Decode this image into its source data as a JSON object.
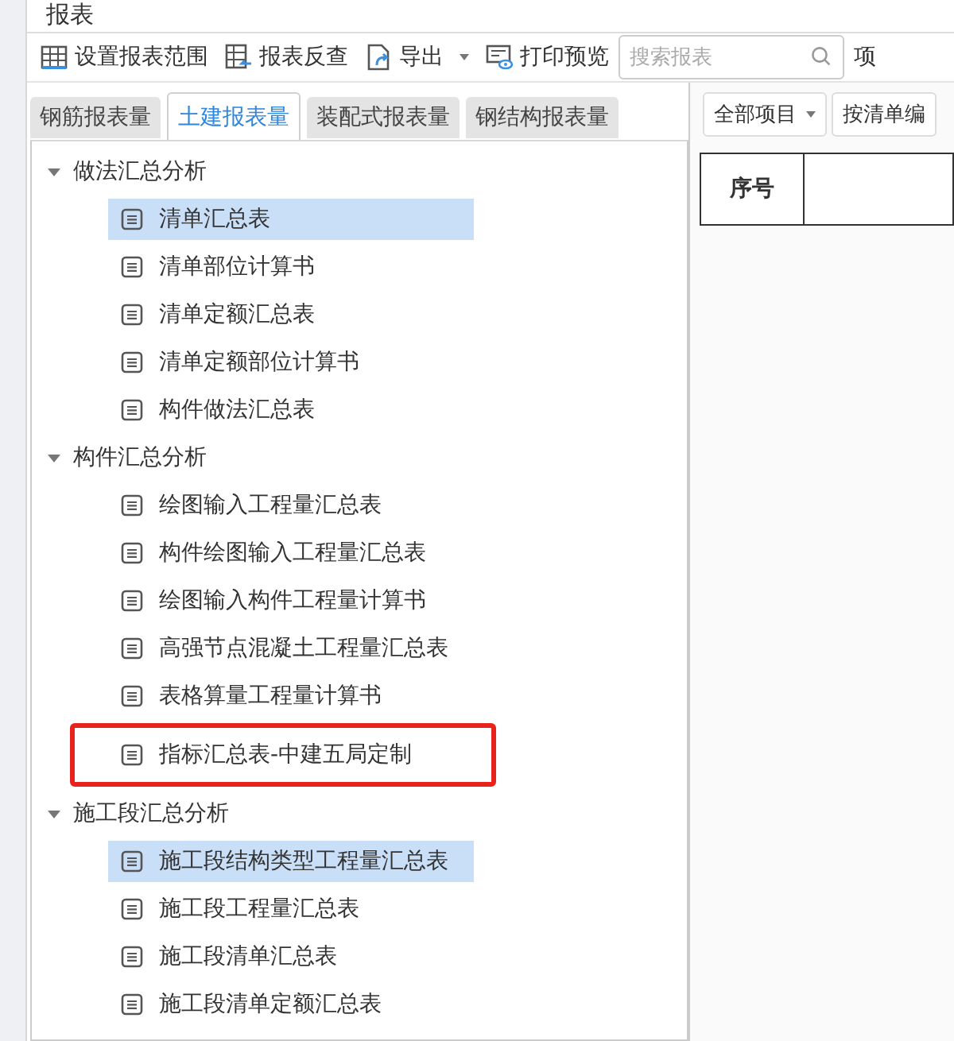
{
  "window": {
    "title": "报表"
  },
  "toolbar": [
    {
      "label": "设置报表范围",
      "kind": "grid"
    },
    {
      "label": "报表反查",
      "kind": "lookup"
    },
    {
      "label": "导出",
      "kind": "export",
      "dropdown": true
    },
    {
      "label": "打印预览",
      "kind": "print"
    }
  ],
  "search": {
    "placeholder": "搜索报表"
  },
  "toolbar_cut_label": "项",
  "tabs": [
    {
      "label": "钢筋报表量",
      "selected": false
    },
    {
      "label": "土建报表量",
      "selected": true
    },
    {
      "label": "装配式报表量",
      "selected": false
    },
    {
      "label": "钢结构报表量",
      "selected": false
    }
  ],
  "tree": [
    {
      "label": "做法汇总分析",
      "expanded": true,
      "children": [
        {
          "label": "清单汇总表",
          "selected": true,
          "highlighted": false
        },
        {
          "label": "清单部位计算书",
          "selected": false,
          "highlighted": false
        },
        {
          "label": "清单定额汇总表",
          "selected": false,
          "highlighted": false
        },
        {
          "label": "清单定额部位计算书",
          "selected": false,
          "highlighted": false
        },
        {
          "label": "构件做法汇总表",
          "selected": false,
          "highlighted": false
        }
      ]
    },
    {
      "label": "构件汇总分析",
      "expanded": true,
      "children": [
        {
          "label": "绘图输入工程量汇总表",
          "selected": false,
          "highlighted": false
        },
        {
          "label": "构件绘图输入工程量汇总表",
          "selected": false,
          "highlighted": false
        },
        {
          "label": "绘图输入构件工程量计算书",
          "selected": false,
          "highlighted": false
        },
        {
          "label": "高强节点混凝土工程量汇总表",
          "selected": false,
          "highlighted": false
        },
        {
          "label": "表格算量工程量计算书",
          "selected": false,
          "highlighted": false
        },
        {
          "label": "指标汇总表-中建五局定制",
          "selected": false,
          "highlighted": true
        }
      ]
    },
    {
      "label": "施工段汇总分析",
      "expanded": true,
      "children": [
        {
          "label": "施工段结构类型工程量汇总表",
          "selected": true,
          "highlighted": false
        },
        {
          "label": "施工段工程量汇总表",
          "selected": false,
          "highlighted": false
        },
        {
          "label": "施工段清单汇总表",
          "selected": false,
          "highlighted": false
        },
        {
          "label": "施工段清单定额汇总表",
          "selected": false,
          "highlighted": false
        }
      ]
    }
  ],
  "right_panel": {
    "filter": "全部项目",
    "sort": "按清单编",
    "table": {
      "columns": [
        "序号"
      ]
    }
  }
}
